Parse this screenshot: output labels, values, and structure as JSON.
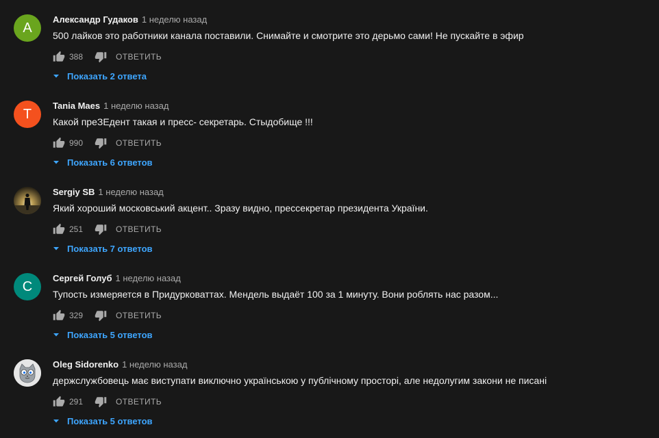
{
  "colors": {
    "background": "#181818",
    "text_primary": "#f1f1f1",
    "text_secondary": "#aaaaaa",
    "link": "#3ea6ff"
  },
  "comments": [
    {
      "avatar_letter": "А",
      "avatar_color": "#6aa51e",
      "author": "Александр Гудаков",
      "time": "1 неделю назад",
      "text": "500 лайков это работники канала поставили. Снимайте и смотрите это дерьмо сами! Не пускайте в эфир",
      "likes": "388",
      "reply_label": "ОТВЕТИТЬ",
      "replies_label": "Показать 2 ответа"
    },
    {
      "avatar_letter": "T",
      "avatar_color": "#f4511e",
      "author": "Tania Maes",
      "time": "1 неделю назад",
      "text": "Какой преЗЕдент такая и пресс- секретарь. Стыдобище !!!",
      "likes": "990",
      "reply_label": "ОТВЕТИТЬ",
      "replies_label": "Показать 6 ответов"
    },
    {
      "avatar_letter": "",
      "avatar_color": "#2a2416",
      "author": "Sergiy SB",
      "time": "1 неделю назад",
      "text": "Який хороший московський акцент.. Зразу видно, прессекретар президента України.",
      "likes": "251",
      "reply_label": "ОТВЕТИТЬ",
      "replies_label": "Показать 7 ответов"
    },
    {
      "avatar_letter": "С",
      "avatar_color": "#00897b",
      "author": "Сергей Голуб",
      "time": "1 неделю назад",
      "text": "Тупость измеряется в Придурковаттах. Мендель выдаёт 100 за 1 минуту. Вони роблять нас разом...",
      "likes": "329",
      "reply_label": "ОТВЕТИТЬ",
      "replies_label": "Показать 5 ответов"
    },
    {
      "avatar_letter": "",
      "avatar_color": "#e6e6e6",
      "author": "Oleg Sidorenko",
      "time": "1 неделю назад",
      "text": "держслужбовець має виступати виключно українською у публічному просторі, але недолугим закони не писані",
      "likes": "291",
      "reply_label": "ОТВЕТИТЬ",
      "replies_label": "Показать 5 ответов"
    }
  ],
  "icons": {
    "like": "thumbs-up-icon",
    "dislike": "thumbs-down-icon",
    "expand": "caret-down-icon"
  }
}
